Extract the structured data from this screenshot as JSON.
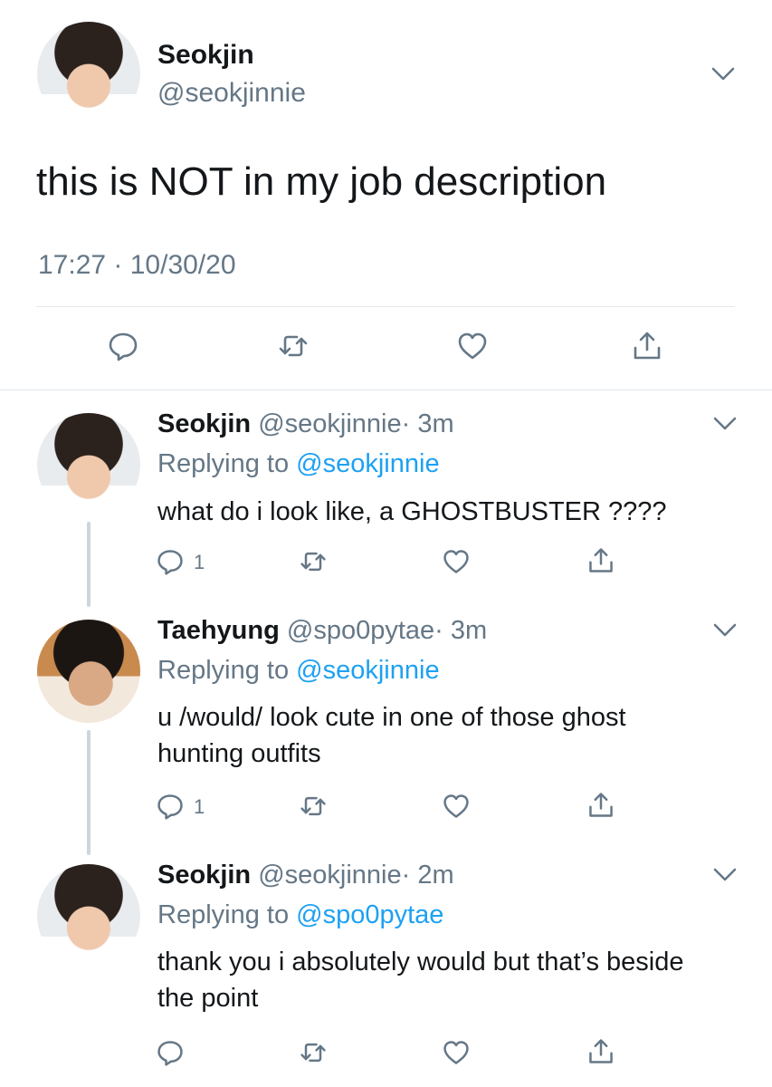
{
  "main_tweet": {
    "display_name": "Seokjin",
    "handle": "@seokjinnie",
    "text": "this is NOT in my job description",
    "timestamp": "17:27 · 10/30/20"
  },
  "replies": [
    {
      "display_name": "Seokjin",
      "handle": "@seokjinnie",
      "time": "· 3m",
      "replying_prefix": "Replying to",
      "replying_to": "@seokjinnie",
      "text": "what do i look like, a GHOSTBUSTER ????",
      "reply_count": "1"
    },
    {
      "display_name": "Taehyung",
      "handle": "@spo0pytae",
      "time": "· 3m",
      "replying_prefix": "Replying to",
      "replying_to": "@seokjinnie",
      "text": "u /would/ look cute in one of those ghost hunting outfits",
      "reply_count": "1"
    },
    {
      "display_name": "Seokjin",
      "handle": "@seokjinnie",
      "time": "· 2m",
      "replying_prefix": "Replying to",
      "replying_to": "@spo0pytae",
      "text": "thank you i absolutely would but that’s beside the point",
      "reply_count": ""
    }
  ],
  "icons": [
    "comment-icon",
    "retweet-icon",
    "like-icon",
    "share-icon",
    "chevron-down-icon"
  ],
  "colors": {
    "text": "#14171a",
    "muted": "#657786",
    "link": "#1da1f2",
    "divider": "#e1e8ed"
  }
}
